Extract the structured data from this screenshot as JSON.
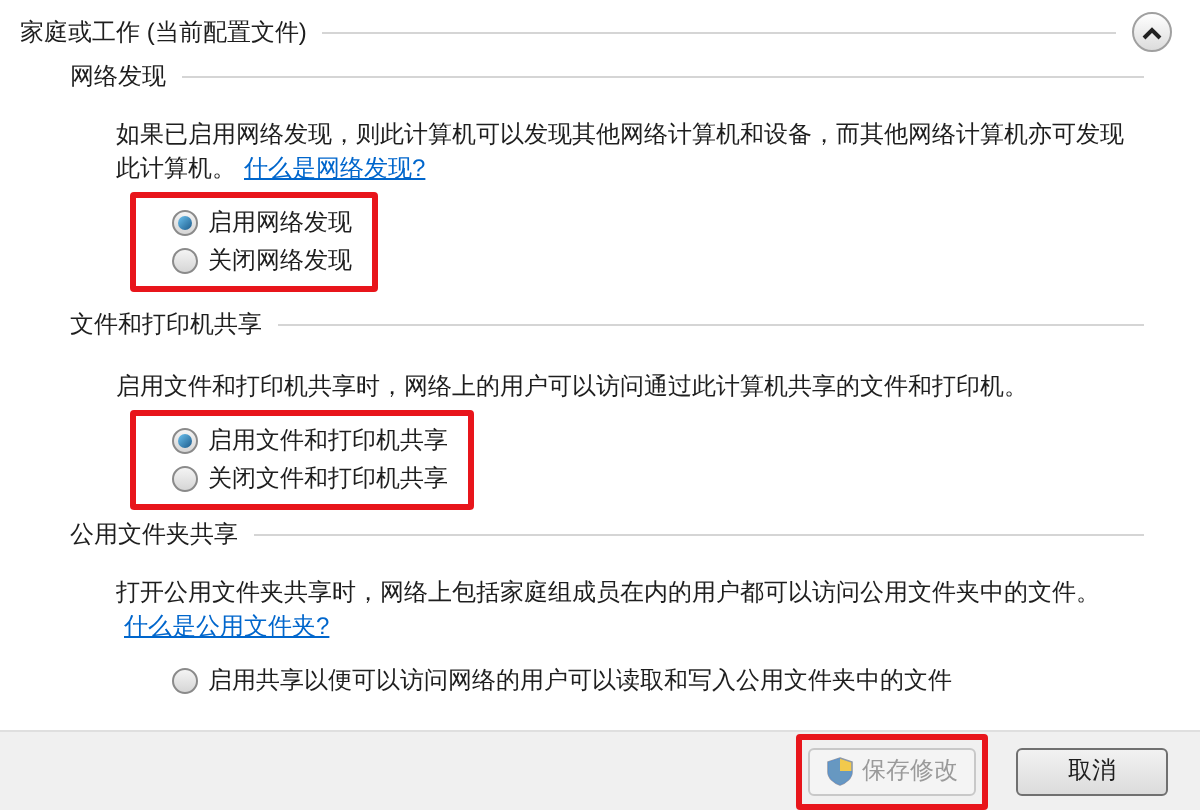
{
  "section": {
    "title": "家庭或工作 (当前配置文件)",
    "expanded": true
  },
  "groups": [
    {
      "heading": "网络发现",
      "description": "如果已启用网络发现，则此计算机可以发现其他网络计算机和设备，而其他网络计算机亦可发现此计算机。",
      "link": "什么是网络发现?",
      "highlighted": true,
      "options": [
        {
          "label": "启用网络发现",
          "selected": true
        },
        {
          "label": "关闭网络发现",
          "selected": false
        }
      ]
    },
    {
      "heading": "文件和打印机共享",
      "description": "启用文件和打印机共享时，网络上的用户可以访问通过此计算机共享的文件和打印机。",
      "highlighted": true,
      "options": [
        {
          "label": "启用文件和打印机共享",
          "selected": true
        },
        {
          "label": "关闭文件和打印机共享",
          "selected": false
        }
      ]
    },
    {
      "heading": "公用文件夹共享",
      "description": "打开公用文件夹共享时，网络上包括家庭组成员在内的用户都可以访问公用文件夹中的文件。",
      "link": "什么是公用文件夹?",
      "highlighted": false,
      "options": [
        {
          "label": "启用共享以便可以访问网络的用户可以读取和写入公用文件夹中的文件",
          "selected": false
        }
      ]
    }
  ],
  "buttons": [
    {
      "label": "保存修改",
      "kind": "shield",
      "disabled": true,
      "highlighted": true
    },
    {
      "label": "取消",
      "kind": "plain",
      "disabled": false,
      "highlighted": false
    }
  ]
}
